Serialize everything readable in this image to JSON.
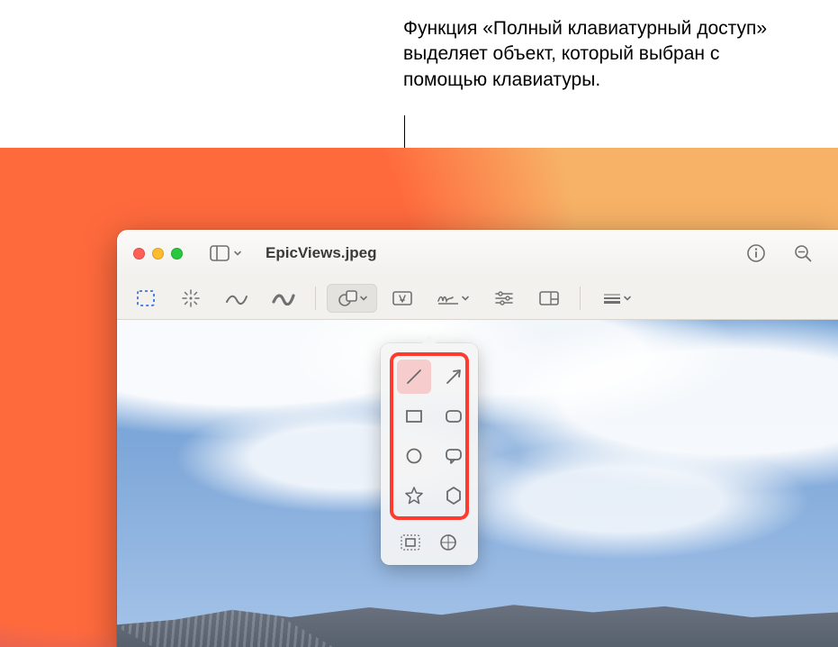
{
  "callout": {
    "text": "Функция «Полный клавиатурный доступ» выделяет объект, который выбран с помощью клавиатуры."
  },
  "window": {
    "title": "EpicViews.jpeg"
  },
  "icons": {
    "sidebar": "sidebar-icon",
    "info": "info-icon",
    "search": "search-icon",
    "zoomout": "zoom-out-icon"
  }
}
